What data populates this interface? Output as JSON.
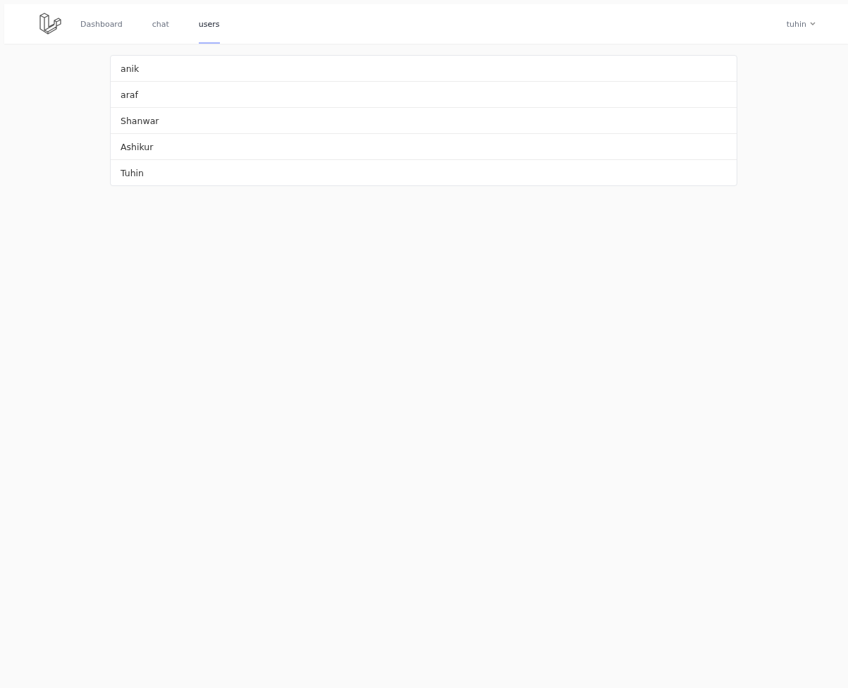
{
  "nav": {
    "links": [
      {
        "label": "Dashboard",
        "selected": false
      },
      {
        "label": "chat",
        "selected": false
      },
      {
        "label": "users",
        "selected": true
      }
    ],
    "user_menu": {
      "label": "tuhin"
    }
  },
  "users": [
    "anik",
    "araf",
    "Shanwar",
    "Ashikur",
    "Tuhin"
  ]
}
